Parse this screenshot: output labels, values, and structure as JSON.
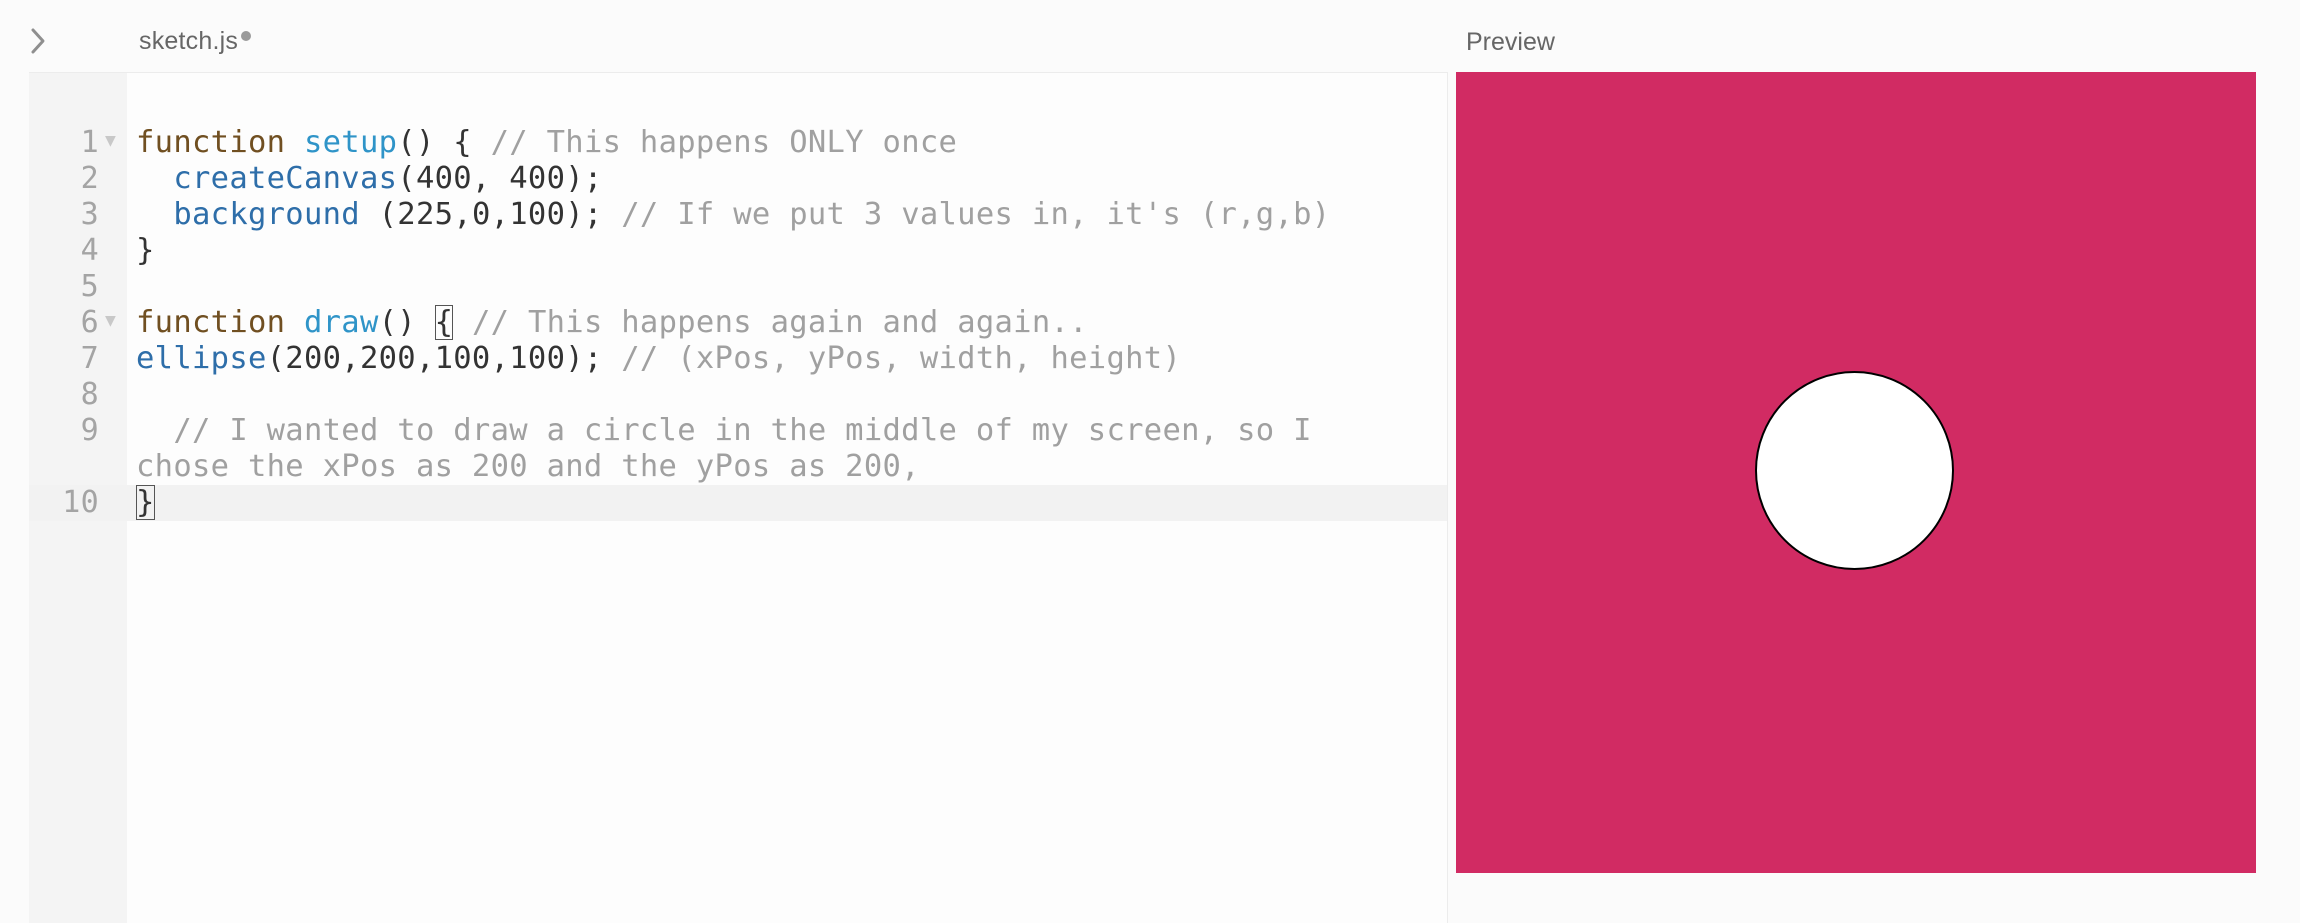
{
  "tab": {
    "filename": "sketch.js",
    "unsaved": true
  },
  "preview": {
    "label": "Preview"
  },
  "colors": {
    "canvas_bg": "#d12b63",
    "ellipse_fill": "#ffffff",
    "ellipse_stroke": "#000000"
  },
  "editor": {
    "active_line": 10,
    "lines": [
      {
        "n": "1",
        "parts": [
          [
            "kw",
            "function "
          ],
          [
            "fn",
            "setup"
          ],
          [
            "",
            "() { "
          ],
          [
            "cm",
            "// This happens ONLY once"
          ]
        ]
      },
      {
        "n": "2",
        "parts": [
          [
            "",
            "  "
          ],
          [
            "fnb",
            "createCanvas"
          ],
          [
            "",
            "(400, 400);"
          ]
        ]
      },
      {
        "n": "3",
        "parts": [
          [
            "",
            "  "
          ],
          [
            "fnb",
            "background"
          ],
          [
            "",
            " (225,0,100); "
          ],
          [
            "cm",
            "// If we put 3 values in, it's (r,g,b)"
          ]
        ]
      },
      {
        "n": "4",
        "parts": [
          [
            "",
            "}"
          ]
        ]
      },
      {
        "n": "5",
        "parts": []
      },
      {
        "n": "6",
        "parts": [
          [
            "kw",
            "function "
          ],
          [
            "fn",
            "draw"
          ],
          [
            "",
            "() "
          ],
          [
            "box",
            "{"
          ],
          [
            "",
            " "
          ],
          [
            "cm",
            "// This happens again and again.."
          ]
        ]
      },
      {
        "n": "7",
        "parts": [
          [
            "fnb",
            "ellipse"
          ],
          [
            "",
            "(200,200,100,100); "
          ],
          [
            "cm",
            "// (xPos, yPos, width, height)"
          ]
        ]
      },
      {
        "n": "8",
        "parts": []
      },
      {
        "n": "9",
        "parts": [
          [
            "cm",
            "  // I wanted to draw a circle in the middle of my screen, so I chose the xPos as 200 and the yPos as 200,"
          ]
        ]
      },
      {
        "n": "10",
        "parts": [
          [
            "box",
            "}"
          ]
        ]
      }
    ]
  }
}
